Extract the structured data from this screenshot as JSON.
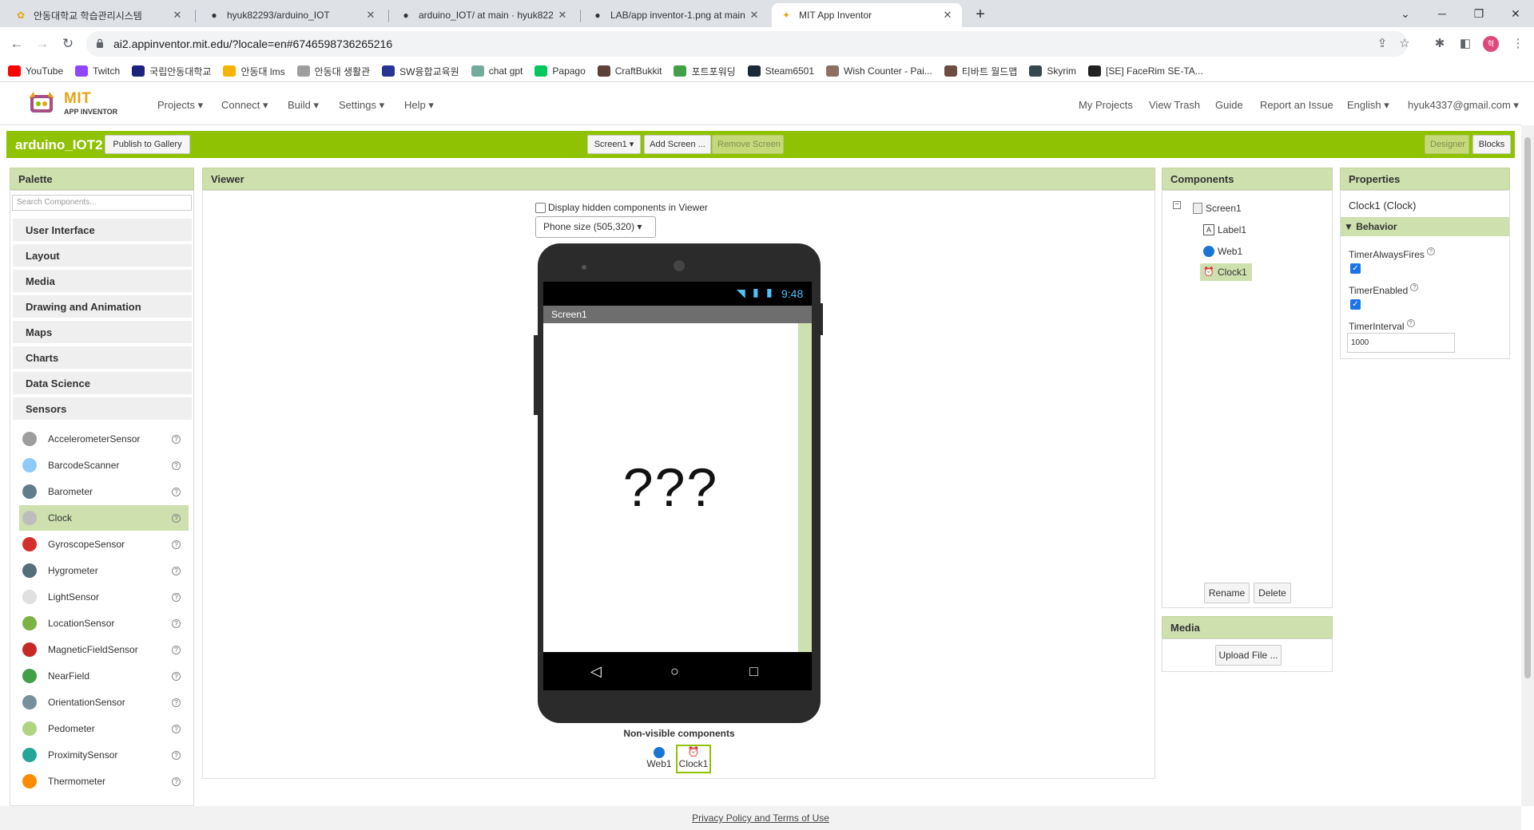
{
  "browser": {
    "tabs": [
      {
        "title": "안동대학교 학습관리시스템",
        "icon": "lms-icon"
      },
      {
        "title": "hyuk82293/arduino_IOT",
        "icon": "github-icon"
      },
      {
        "title": "arduino_IOT/ at main · hyuk822",
        "icon": "github-icon"
      },
      {
        "title": "LAB/app inventor-1.png at main",
        "icon": "github-icon"
      },
      {
        "title": "MIT App Inventor",
        "icon": "app-inventor-icon"
      }
    ],
    "url": "ai2.appinventor.mit.edu/?locale=en#6746598736265216",
    "profile_initial": "혁",
    "bookmarks": [
      {
        "label": "YouTube",
        "color": "#ff0000"
      },
      {
        "label": "Twitch",
        "color": "#9146ff"
      },
      {
        "label": "국립안동대학교",
        "color": "#1a237e"
      },
      {
        "label": "안동대 lms",
        "color": "#f4b400"
      },
      {
        "label": "안동대 생활관",
        "color": "#9e9e9e"
      },
      {
        "label": "SW융합교육원",
        "color": "#283593"
      },
      {
        "label": "chat gpt",
        "color": "#74aa9c"
      },
      {
        "label": "Papago",
        "color": "#03c75a"
      },
      {
        "label": "CraftBukkit",
        "color": "#5d4037"
      },
      {
        "label": "포트포워딩",
        "color": "#43a047"
      },
      {
        "label": "Steam6501",
        "color": "#1b2838"
      },
      {
        "label": "Wish Counter - Pai...",
        "color": "#8d6e63"
      },
      {
        "label": "티바트 월드맵",
        "color": "#6d4c41"
      },
      {
        "label": "Skyrim",
        "color": "#37474f"
      },
      {
        "label": "[SE] FaceRim SE-TA...",
        "color": "#212121"
      }
    ]
  },
  "header": {
    "logo_main": "MIT",
    "logo_sub": "APP INVENTOR",
    "menu": [
      "Projects ▾",
      "Connect ▾",
      "Build ▾",
      "Settings ▾",
      "Help ▾"
    ],
    "right_menu": [
      "My Projects",
      "View Trash",
      "Guide",
      "Report an Issue",
      "English ▾",
      "hyuk4337@gmail.com ▾"
    ]
  },
  "project_bar": {
    "name": "arduino_IOT2",
    "publish_label": "Publish to Gallery",
    "screen_select": "Screen1 ▾",
    "add_screen": "Add Screen ...",
    "remove_screen": "Remove Screen",
    "designer": "Designer",
    "blocks": "Blocks"
  },
  "palette": {
    "title": "Palette",
    "search_placeholder": "Search Components...",
    "categories": [
      "User Interface",
      "Layout",
      "Media",
      "Drawing and Animation",
      "Maps",
      "Charts",
      "Data Science",
      "Sensors"
    ],
    "sensors": [
      "AccelerometerSensor",
      "BarcodeScanner",
      "Barometer",
      "Clock",
      "GyroscopeSensor",
      "Hygrometer",
      "LightSensor",
      "LocationSensor",
      "MagneticFieldSensor",
      "NearField",
      "OrientationSensor",
      "Pedometer",
      "ProximitySensor",
      "Thermometer"
    ],
    "selected": "Clock"
  },
  "viewer": {
    "title": "Viewer",
    "hidden_label": "Display hidden components in Viewer",
    "phone_size": "Phone size (505,320) ▾",
    "status_time": "9:48",
    "screen_title": "Screen1",
    "label_text": "???",
    "nonvisible_title": "Non-visible components",
    "nonvisible": [
      "Web1",
      "Clock1"
    ]
  },
  "components": {
    "title": "Components",
    "tree": [
      "Screen1",
      "Label1",
      "Web1",
      "Clock1"
    ],
    "selected": "Clock1",
    "rename": "Rename",
    "delete": "Delete"
  },
  "media": {
    "title": "Media",
    "upload": "Upload File ..."
  },
  "properties": {
    "title": "Properties",
    "component": "Clock1 (Clock)",
    "section": "Behavior",
    "timer_always_fires": "TimerAlwaysFires",
    "timer_enabled": "TimerEnabled",
    "timer_interval": "TimerInterval",
    "timer_interval_value": "1000",
    "timer_always_fires_checked": true,
    "timer_enabled_checked": true
  },
  "footer": "Privacy Policy and Terms of Use",
  "colors": {
    "accent_green": "#8fc202",
    "panel_header": "#cee0ae"
  }
}
